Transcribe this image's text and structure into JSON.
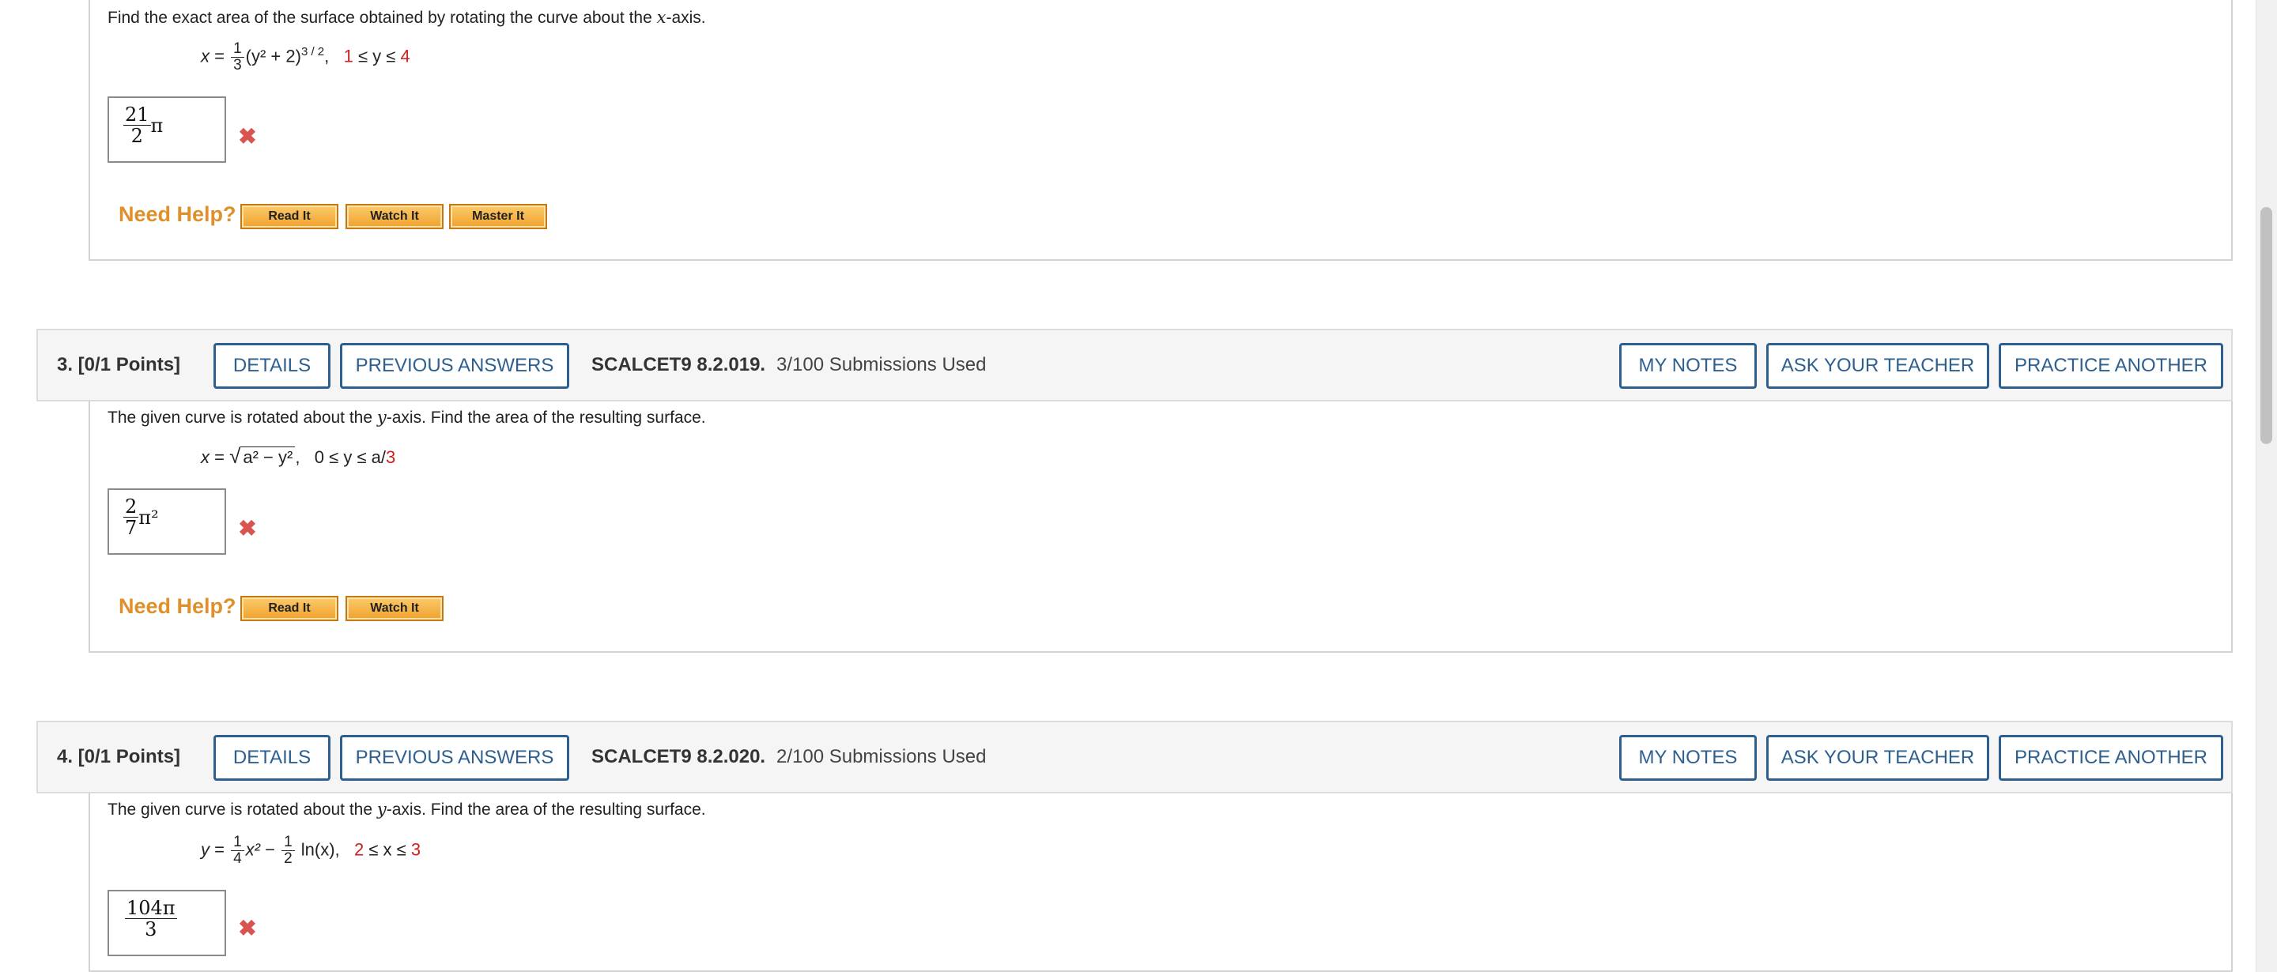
{
  "question2": {
    "prompt_before": "Find the exact area of the surface obtained by rotating the curve about the ",
    "prompt_axis": "x",
    "prompt_after": "-axis.",
    "formula": {
      "lhs": "x",
      "eq": " = ",
      "frac_num": "1",
      "frac_den": "3",
      "body": "(y² + 2)",
      "exp": "3 / 2",
      "comma": ",",
      "range_low": "1",
      "range_mid": " ≤ y ≤ ",
      "range_high": "4"
    },
    "answer": {
      "num": "21",
      "den": "2",
      "suffix": "π"
    },
    "result_icon": "wrong-x-icon",
    "need_help": "Need Help?",
    "help_buttons": [
      "Read It",
      "Watch It",
      "Master It"
    ]
  },
  "question3": {
    "label": "3.  [0/1 Points]",
    "details": "DETAILS",
    "previous_answers": "PREVIOUS ANSWERS",
    "code": "SCALCET9 8.2.019.",
    "submissions": "3/100 Submissions Used",
    "my_notes": "MY NOTES",
    "ask_teacher": "ASK YOUR TEACHER",
    "practice_another": "PRACTICE ANOTHER",
    "prompt_before": "The given curve is rotated about the ",
    "prompt_axis": "y",
    "prompt_after": "-axis. Find the area of the resulting surface.",
    "formula": {
      "lhs": "x",
      "eq": " = ",
      "radicand": "a² − y²",
      "comma": ",",
      "range": "0 ≤ y ≤ a/",
      "range_high": "3"
    },
    "answer": {
      "num": "2",
      "den": "7",
      "suffix": "π²"
    },
    "result_icon": "wrong-x-icon",
    "need_help": "Need Help?",
    "help_buttons": [
      "Read It",
      "Watch It"
    ]
  },
  "question4": {
    "label": "4.  [0/1 Points]",
    "details": "DETAILS",
    "previous_answers": "PREVIOUS ANSWERS",
    "code": "SCALCET9 8.2.020.",
    "submissions": "2/100 Submissions Used",
    "my_notes": "MY NOTES",
    "ask_teacher": "ASK YOUR TEACHER",
    "practice_another": "PRACTICE ANOTHER",
    "prompt_before": "The given curve is rotated about the ",
    "prompt_axis": "y",
    "prompt_after": "-axis. Find the area of the resulting surface.",
    "formula": {
      "lhs": "y",
      "eq": " = ",
      "frac1_num": "1",
      "frac1_den": "4",
      "term1": "x²",
      "minus": " − ",
      "frac2_num": "1",
      "frac2_den": "2",
      "term2": " ln(x),",
      "range_low": "2",
      "range_mid": " ≤ x ≤ ",
      "range_high": "3"
    },
    "answer": {
      "num": "104π",
      "den": "3"
    },
    "result_icon": "wrong-x-icon"
  },
  "colors": {
    "accent_blue": "#2d5f8f",
    "need_help_orange": "#e0902a",
    "wrong_red": "#d9534f",
    "range_red": "#d01e1e"
  }
}
